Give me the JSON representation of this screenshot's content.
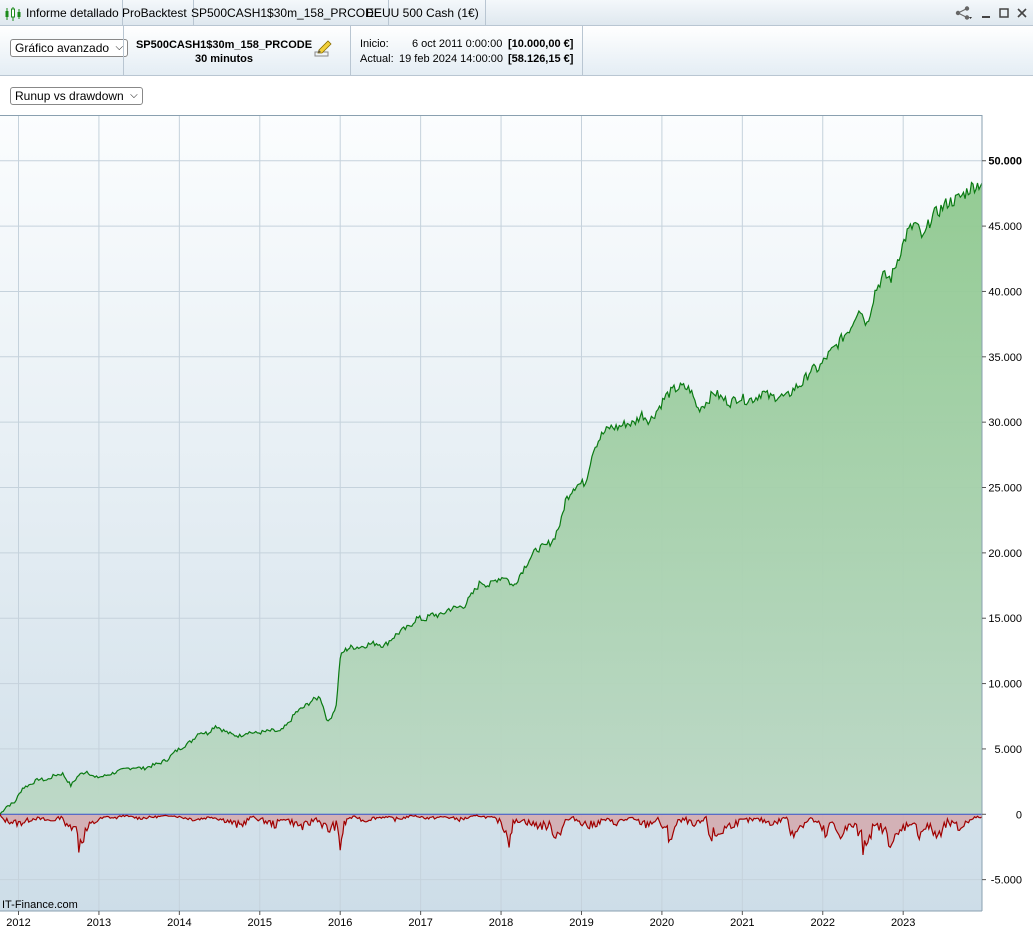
{
  "titlebar": {
    "tabs": [
      "Informe detallado",
      "ProBacktest",
      "SP500CASH1$30m_158_PRCODE",
      "EEUU 500 Cash (1€)"
    ]
  },
  "header": {
    "view_select": "Gráfico avanzado",
    "instrument": "SP500CASH1$30m_158_PRCODE",
    "timeframe": "30 minutos",
    "start_label": "Inicio:",
    "start_date": "6 oct 2011 0:00:00",
    "start_value": "[10.000,00 €]",
    "current_label": "Actual:",
    "current_date": "19 feb 2024 14:00:00",
    "current_value": "[58.126,15 €]"
  },
  "chart_select": "Runup vs drawdown",
  "watermark": "IT-Finance.com",
  "colors": {
    "runup": "#0a7a12",
    "drawdown": "#a00000",
    "runup_fill": "#8fc98f",
    "drawdown_fill": "#d4a8ad"
  },
  "chart_data": {
    "type": "area",
    "title": "",
    "xlabel": "",
    "ylabel": "",
    "grid": true,
    "x_ticks": [
      "2012",
      "2013",
      "2014",
      "2015",
      "2016",
      "2017",
      "2018",
      "2019",
      "2020",
      "2021",
      "2022",
      "2023"
    ],
    "y_ticks": [
      "50.000",
      "45.000",
      "40.000",
      "35.000",
      "30.000",
      "25.000",
      "20.000",
      "15.000",
      "10.000",
      "5.000",
      "0",
      "-5.000"
    ],
    "ylim": [
      -7400,
      53500
    ],
    "xlim": [
      2011.77,
      2023.98
    ],
    "series": [
      {
        "kind": "runup",
        "x": [
          2011.77,
          2011.85,
          2011.95,
          2012.05,
          2012.15,
          2012.25,
          2012.35,
          2012.45,
          2012.55,
          2012.65,
          2012.75,
          2012.85,
          2012.95,
          2013.05,
          2013.15,
          2013.25,
          2013.35,
          2013.45,
          2013.55,
          2013.65,
          2013.75,
          2013.85,
          2013.95,
          2014.05,
          2014.15,
          2014.25,
          2014.35,
          2014.45,
          2014.55,
          2014.65,
          2014.75,
          2014.85,
          2014.95,
          2015.05,
          2015.15,
          2015.25,
          2015.35,
          2015.45,
          2015.55,
          2015.65,
          2015.75,
          2015.85,
          2015.95,
          2016.0,
          2016.05,
          2016.1,
          2016.15,
          2016.25,
          2016.35,
          2016.45,
          2016.55,
          2016.65,
          2016.75,
          2016.85,
          2016.95,
          2017.05,
          2017.15,
          2017.25,
          2017.35,
          2017.45,
          2017.55,
          2017.65,
          2017.75,
          2017.85,
          2017.95,
          2018.05,
          2018.15,
          2018.25,
          2018.35,
          2018.45,
          2018.55,
          2018.65,
          2018.75,
          2018.8,
          2018.9,
          2018.95,
          2019.05,
          2019.15,
          2019.25,
          2019.35,
          2019.45,
          2019.55,
          2019.65,
          2019.75,
          2019.85,
          2019.95,
          2020.05,
          2020.15,
          2020.25,
          2020.35,
          2020.45,
          2020.55,
          2020.65,
          2020.75,
          2020.85,
          2020.95,
          2021.05,
          2021.15,
          2021.25,
          2021.35,
          2021.45,
          2021.55,
          2021.65,
          2021.75,
          2021.85,
          2021.95,
          2022.05,
          2022.15,
          2022.25,
          2022.35,
          2022.45,
          2022.55,
          2022.65,
          2022.75,
          2022.85,
          2022.95,
          2023.05,
          2023.15,
          2023.25,
          2023.35,
          2023.45,
          2023.55,
          2023.65,
          2023.75,
          2023.85,
          2023.98
        ],
        "y": [
          0,
          600,
          900,
          2000,
          2300,
          2700,
          2600,
          3000,
          3100,
          2200,
          3000,
          3300,
          2800,
          2900,
          3100,
          3300,
          3500,
          3600,
          3500,
          3700,
          3900,
          4200,
          4800,
          5200,
          5600,
          6300,
          6200,
          6800,
          6400,
          6100,
          6000,
          6300,
          6200,
          6300,
          6400,
          6300,
          6900,
          7800,
          8200,
          8700,
          9000,
          7000,
          8300,
          12000,
          12500,
          12700,
          12800,
          12800,
          13000,
          13100,
          12900,
          13500,
          14000,
          14300,
          15000,
          14900,
          15300,
          15200,
          15700,
          15800,
          16000,
          16900,
          17800,
          17500,
          18000,
          18200,
          17400,
          18500,
          19500,
          20300,
          20500,
          21000,
          22500,
          24000,
          25000,
          25200,
          25400,
          28000,
          29000,
          29600,
          29600,
          29900,
          29900,
          30600,
          30100,
          31000,
          32000,
          32500,
          32700,
          32500,
          31000,
          31500,
          32300,
          31800,
          31500,
          31900,
          31700,
          31800,
          32300,
          31900,
          32000,
          31900,
          32600,
          33000,
          34000,
          34100,
          35000,
          35700,
          36500,
          37300,
          38800,
          37500,
          40000,
          41200,
          41000,
          42800,
          44500,
          45200,
          44000,
          45700,
          46200,
          46800,
          47000,
          47400,
          48000,
          48300
        ]
      },
      {
        "kind": "drawdown",
        "x": [
          2011.77,
          2011.8,
          2012.0,
          2012.2,
          2012.4,
          2012.55,
          2012.6,
          2012.7,
          2012.75,
          2012.85,
          2012.9,
          2013.0,
          2013.1,
          2013.2,
          2013.3,
          2013.5,
          2013.7,
          2013.9,
          2014.0,
          2014.2,
          2014.4,
          2014.6,
          2014.75,
          2014.9,
          2015.0,
          2015.2,
          2015.3,
          2015.4,
          2015.55,
          2015.7,
          2015.85,
          2015.95,
          2016.0,
          2016.05,
          2016.1,
          2016.2,
          2016.3,
          2016.4,
          2016.55,
          2016.7,
          2016.9,
          2017.1,
          2017.3,
          2017.5,
          2017.7,
          2017.9,
          2018.0,
          2018.1,
          2018.15,
          2018.25,
          2018.4,
          2018.6,
          2018.7,
          2018.8,
          2018.9,
          2019.1,
          2019.3,
          2019.4,
          2019.6,
          2019.8,
          2019.95,
          2020.05,
          2020.1,
          2020.2,
          2020.3,
          2020.4,
          2020.55,
          2020.6,
          2020.7,
          2020.8,
          2020.9,
          2021.0,
          2021.2,
          2021.4,
          2021.55,
          2021.6,
          2021.7,
          2021.85,
          2021.95,
          2022.05,
          2022.1,
          2022.2,
          2022.3,
          2022.4,
          2022.5,
          2022.6,
          2022.7,
          2022.8,
          2022.9,
          2023.0,
          2023.1,
          2023.2,
          2023.3,
          2023.45,
          2023.55,
          2023.7,
          2023.85,
          2023.98
        ],
        "y": [
          0,
          -400,
          -700,
          -300,
          -500,
          -200,
          -1100,
          -700,
          -2200,
          -1200,
          -800,
          -400,
          -200,
          -300,
          -100,
          -300,
          -200,
          -100,
          -200,
          -400,
          -200,
          -500,
          -900,
          -200,
          -400,
          -800,
          -300,
          -600,
          -1000,
          -300,
          -1200,
          -800,
          -2300,
          -800,
          -300,
          -200,
          -500,
          -300,
          -200,
          -400,
          -100,
          -300,
          -200,
          -400,
          -100,
          -300,
          -600,
          -1800,
          -700,
          -400,
          -800,
          -900,
          -1600,
          -500,
          -300,
          -900,
          -400,
          -700,
          -300,
          -800,
          -400,
          -1300,
          -1800,
          -600,
          -400,
          -1000,
          -300,
          -1700,
          -1500,
          -1000,
          -700,
          -500,
          -400,
          -700,
          -200,
          -1400,
          -1000,
          -300,
          -800,
          -1700,
          -600,
          -1500,
          -1100,
          -800,
          -2300,
          -1300,
          -900,
          -1600,
          -2200,
          -1000,
          -600,
          -1400,
          -900,
          -1800,
          -600,
          -1100,
          -300,
          -200
        ]
      }
    ]
  }
}
